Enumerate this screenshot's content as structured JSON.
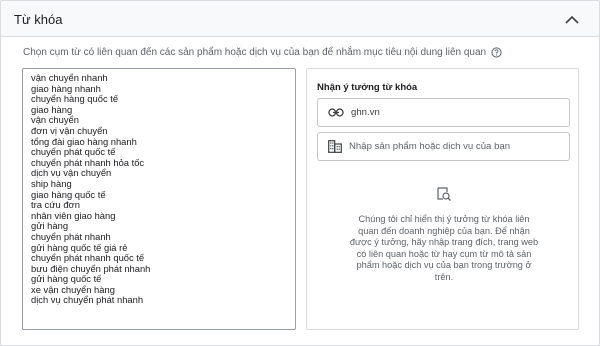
{
  "panel": {
    "title": "Từ khóa",
    "subtitle": "Chọn cụm từ có liên quan đến các sản phẩm hoặc dịch vụ của bạn để nhắm mục tiêu nội dung liên quan"
  },
  "keywords": [
    "vận chuyển nhanh",
    "giao hàng nhanh",
    "chuyển hàng quốc tế",
    "giao hàng",
    "vận chuyển",
    "đơn vị vận chuyển",
    "tổng đài giao hàng nhanh",
    "chuyển phát quốc tế",
    "chuyển phát nhanh hỏa tốc",
    "dịch vụ vận chuyển",
    "ship hàng",
    "giao hàng quốc tế",
    "tra cứu đơn",
    "nhân viên giao hàng",
    "gửi hàng",
    "chuyển phát nhanh",
    "gửi hàng quốc tế giá rẻ",
    "chuyển phát nhanh quốc tế",
    "bưu điện chuyển phát nhanh",
    "gửi hàng quốc tế",
    "xe vận chuyển hàng",
    "dịch vụ chuyển phát nhanh"
  ],
  "ideas": {
    "title": "Nhận ý tưởng từ khóa",
    "url_value": "ghn.vn",
    "product_placeholder": "Nhập sản phẩm hoặc dịch vụ của bạn",
    "empty_message": "Chúng tôi chỉ hiển thị ý tưởng từ khóa liên quan đến doanh nghiệp của bạn. Để nhận được ý tưởng, hãy nhập trang đích, trang web có liên quan hoặc từ hay cụm từ mô tả sản phẩm hoặc dịch vụ của bạn trong trường ở trên."
  },
  "icons": {
    "collapse": "chevron-up-icon",
    "help": "help-circle-icon",
    "url": "link-icon",
    "product": "business-icon",
    "empty": "search-document-icon"
  }
}
